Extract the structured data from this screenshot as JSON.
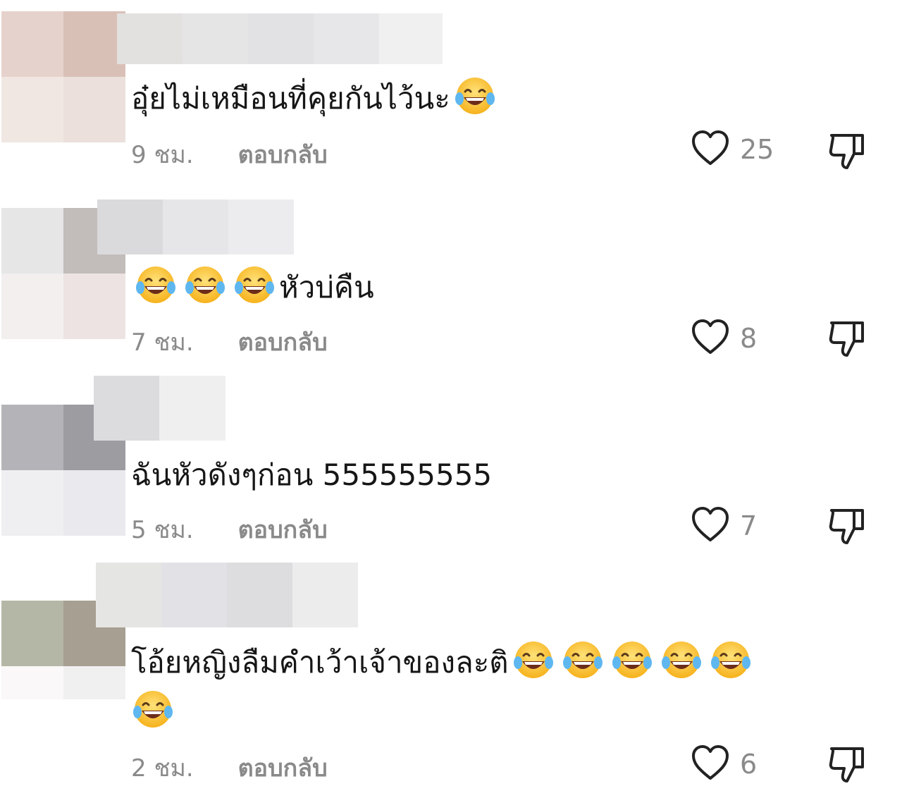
{
  "comments": [
    {
      "text": "อุ๋ยไม่เหมือนที่คุยกันไว้นะ",
      "emojis_after": 1,
      "time": "9 ชม.",
      "reply": "ตอบกลับ",
      "likes": "25",
      "avatar_colors": [
        "#e6d2cc",
        "#d9c0b7",
        "#f0e6e2",
        "#ebe0dc"
      ],
      "name_colors": [
        "#e3e0e0",
        "#e6e5e6",
        "#e2e2e4",
        "#e7e6e8",
        "#f0f0f0"
      ]
    },
    {
      "emojis_before": 3,
      "text": "หัวบ่คืน",
      "time": "7 ชม.",
      "reply": "ตอบกลับ",
      "likes": "8",
      "avatar_colors": [
        "#e6e6e6",
        "#c2bcba",
        "#f3efef",
        "#ede3e2"
      ],
      "name_colors": [
        "#dadadc",
        "#e6e6e8",
        "#ececee"
      ]
    },
    {
      "text": "ฉันหัวดังๆก่อน 555555555",
      "time": "5 ชม.",
      "reply": "ตอบกลับ",
      "likes": "7",
      "avatar_colors": [
        "#b4b4b8",
        "#9c9ca1",
        "#efeff1",
        "#eaeaee"
      ],
      "name_colors": [
        "#dcdcde",
        "#efefef"
      ]
    },
    {
      "text": "โอ้ยหญิงลืมคำเว้าเจ้าของละติ",
      "emojis_after": 5,
      "emojis_line2": 1,
      "time": "2 ชม.",
      "reply": "ตอบกลับ",
      "likes": "6",
      "avatar_colors": [
        "#b5b7a6",
        "#a69f92",
        "#faf8f8",
        "#f1f0f1"
      ],
      "name_colors": [
        "#e5e5e3",
        "#e2e2e6",
        "#dddddf",
        "#ececec"
      ]
    }
  ],
  "icons": {
    "like": "heart-outline-icon",
    "dislike": "thumbs-down-icon",
    "emoji": "face-with-tears-of-joy-icon"
  }
}
